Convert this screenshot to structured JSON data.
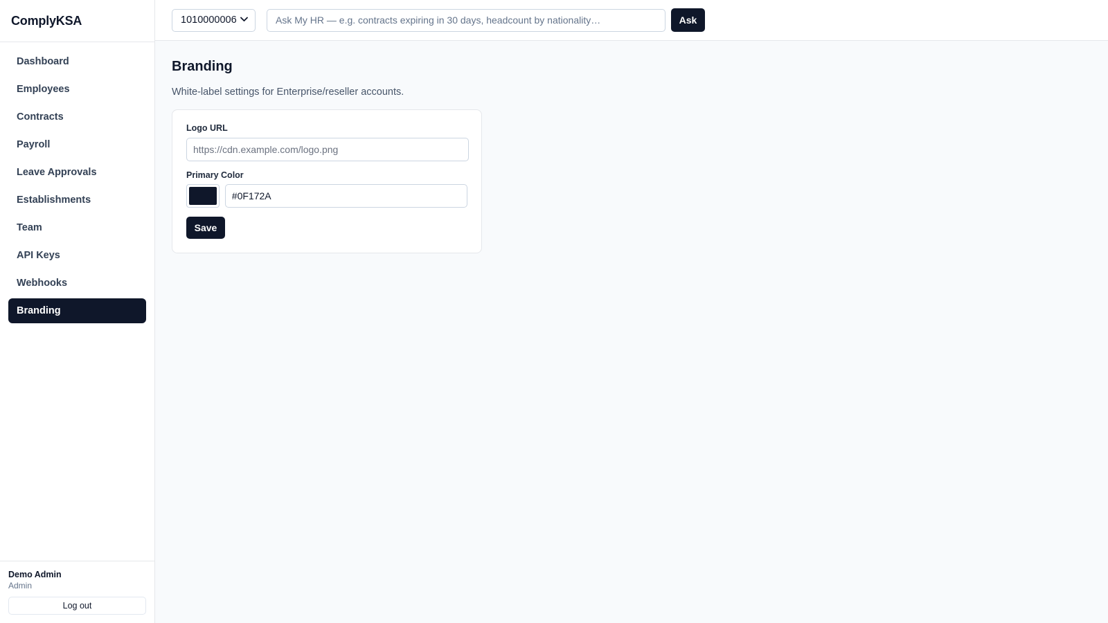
{
  "app": {
    "name": "ComplyKSA"
  },
  "sidebar": {
    "items": [
      {
        "label": "Dashboard",
        "active": false
      },
      {
        "label": "Employees",
        "active": false
      },
      {
        "label": "Contracts",
        "active": false
      },
      {
        "label": "Payroll",
        "active": false
      },
      {
        "label": "Leave Approvals",
        "active": false
      },
      {
        "label": "Establishments",
        "active": false
      },
      {
        "label": "Team",
        "active": false
      },
      {
        "label": "API Keys",
        "active": false
      },
      {
        "label": "Webhooks",
        "active": false
      },
      {
        "label": "Branding",
        "active": true
      }
    ],
    "user": {
      "name": "Demo Admin",
      "role": "Admin"
    },
    "logout_label": "Log out"
  },
  "topbar": {
    "establishment_select": {
      "value": "1010000006"
    },
    "ask": {
      "placeholder": "Ask My HR — e.g. contracts expiring in 30 days, headcount by nationality…",
      "button_label": "Ask"
    }
  },
  "page": {
    "title": "Branding",
    "subtitle": "White-label settings for Enterprise/reseller accounts."
  },
  "form": {
    "logo_url": {
      "label": "Logo URL",
      "placeholder": "https://cdn.example.com/logo.png",
      "value": ""
    },
    "primary_color": {
      "label": "Primary Color",
      "value": "#0F172A",
      "swatch_color": "#0f172a"
    },
    "save_label": "Save"
  },
  "colors": {
    "accent": "#0f172a",
    "background": "#f8fafc",
    "border": "#e5e7eb"
  }
}
